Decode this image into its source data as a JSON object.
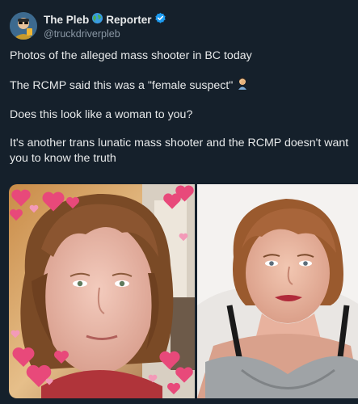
{
  "author": {
    "display_name_part1": "The Pleb",
    "display_name_part2": "Reporter",
    "handle": "@truckdriverpleb",
    "verified": true,
    "name_emoji_icon": "globe-icon",
    "verified_icon": "verified-badge-icon"
  },
  "post": {
    "line1": "Photos of the alleged mass shooter in BC today",
    "line2": "The RCMP said this was a \"female suspect\"",
    "line2_emoji": "person-facepalming-icon",
    "line3": "Does this look like a woman to you?",
    "line4": "It's another trans lunatic mass shooter and the RCMP doesn't want you to know the truth"
  },
  "media": {
    "count": 2,
    "photo_left_icon": "photo-with-heart-stickers",
    "photo_right_icon": "photo-portrait"
  },
  "colors": {
    "background": "#15202b",
    "text_primary": "#e7e9ea",
    "text_secondary": "#8b98a5",
    "verified": "#1d9bf0"
  }
}
